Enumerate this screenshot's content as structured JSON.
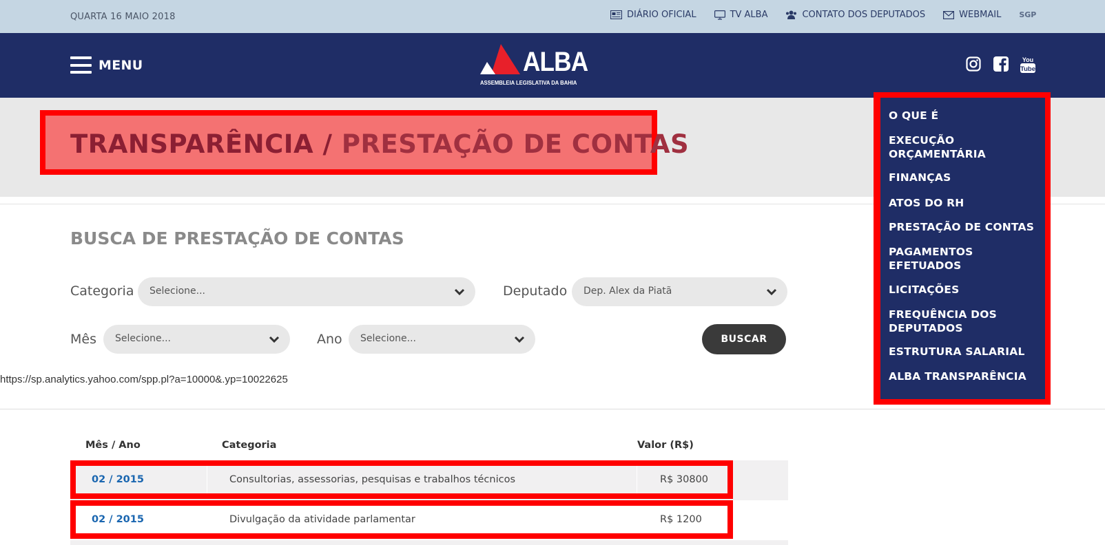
{
  "topbar": {
    "date": "QUARTA 16 MAIO 2018",
    "links": [
      {
        "label": "DIÁRIO OFICIAL",
        "icon": "newspaper-icon"
      },
      {
        "label": "TV ALBA",
        "icon": "monitor-icon"
      },
      {
        "label": "CONTATO DOS DEPUTADOS",
        "icon": "users-icon"
      },
      {
        "label": "WEBMAIL",
        "icon": "envelope-icon"
      },
      {
        "label": "SGP",
        "icon": "sgp-icon"
      }
    ]
  },
  "navbar": {
    "menu_label": "MENU",
    "logo_word": "ALBA",
    "logo_sub": "ASSEMBLEIA LEGISLATIVA DA BAHIA",
    "social": [
      "instagram-icon",
      "facebook-icon",
      "youtube-icon"
    ],
    "youtube_text": "You Tube"
  },
  "page_title": {
    "part1": "TRANSPARÊNCIA / ",
    "part2": "PRESTAÇÃO DE CONTAS"
  },
  "search": {
    "title": "BUSCA DE PRESTAÇÃO DE CONTAS",
    "categoria_label": "Categoria",
    "categoria_value": "Selecione...",
    "deputado_label": "Deputado",
    "deputado_value": "Dep. Alex da Piatã",
    "mes_label": "Mês",
    "mes_value": "Selecione...",
    "ano_label": "Ano",
    "ano_value": "Selecione...",
    "button": "BUSCAR"
  },
  "status_url": "https://sp.analytics.yahoo.com/spp.pl?a=10000&.yp=10022625",
  "table": {
    "headers": [
      "Mês / Ano",
      "Categoria",
      "Valor (R$)"
    ],
    "rows": [
      {
        "date": "02 / 2015",
        "category": "Consultorias, assessorias, pesquisas e trabalhos técnicos",
        "value": "R$ 30800"
      },
      {
        "date": "02 / 2015",
        "category": "Divulgação da atividade parlamentar",
        "value": "R$ 1200"
      }
    ]
  },
  "side_menu": {
    "items": [
      "O QUE É",
      "EXECUÇÃO ORÇAMENTÁRIA",
      "FINANÇAS",
      "ATOS DO RH",
      "PRESTAÇÃO DE CONTAS",
      "PAGAMENTOS EFETUADOS",
      "LICITAÇÕES",
      "FREQUÊNCIA DOS DEPUTADOS",
      "ESTRUTURA SALARIAL",
      "ALBA TRANSPARÊNCIA"
    ]
  },
  "colors": {
    "navy": "#1f2d66",
    "topbar": "#c5d6e3",
    "highlight": "#ff0000",
    "link_blue": "#1a66b0"
  }
}
